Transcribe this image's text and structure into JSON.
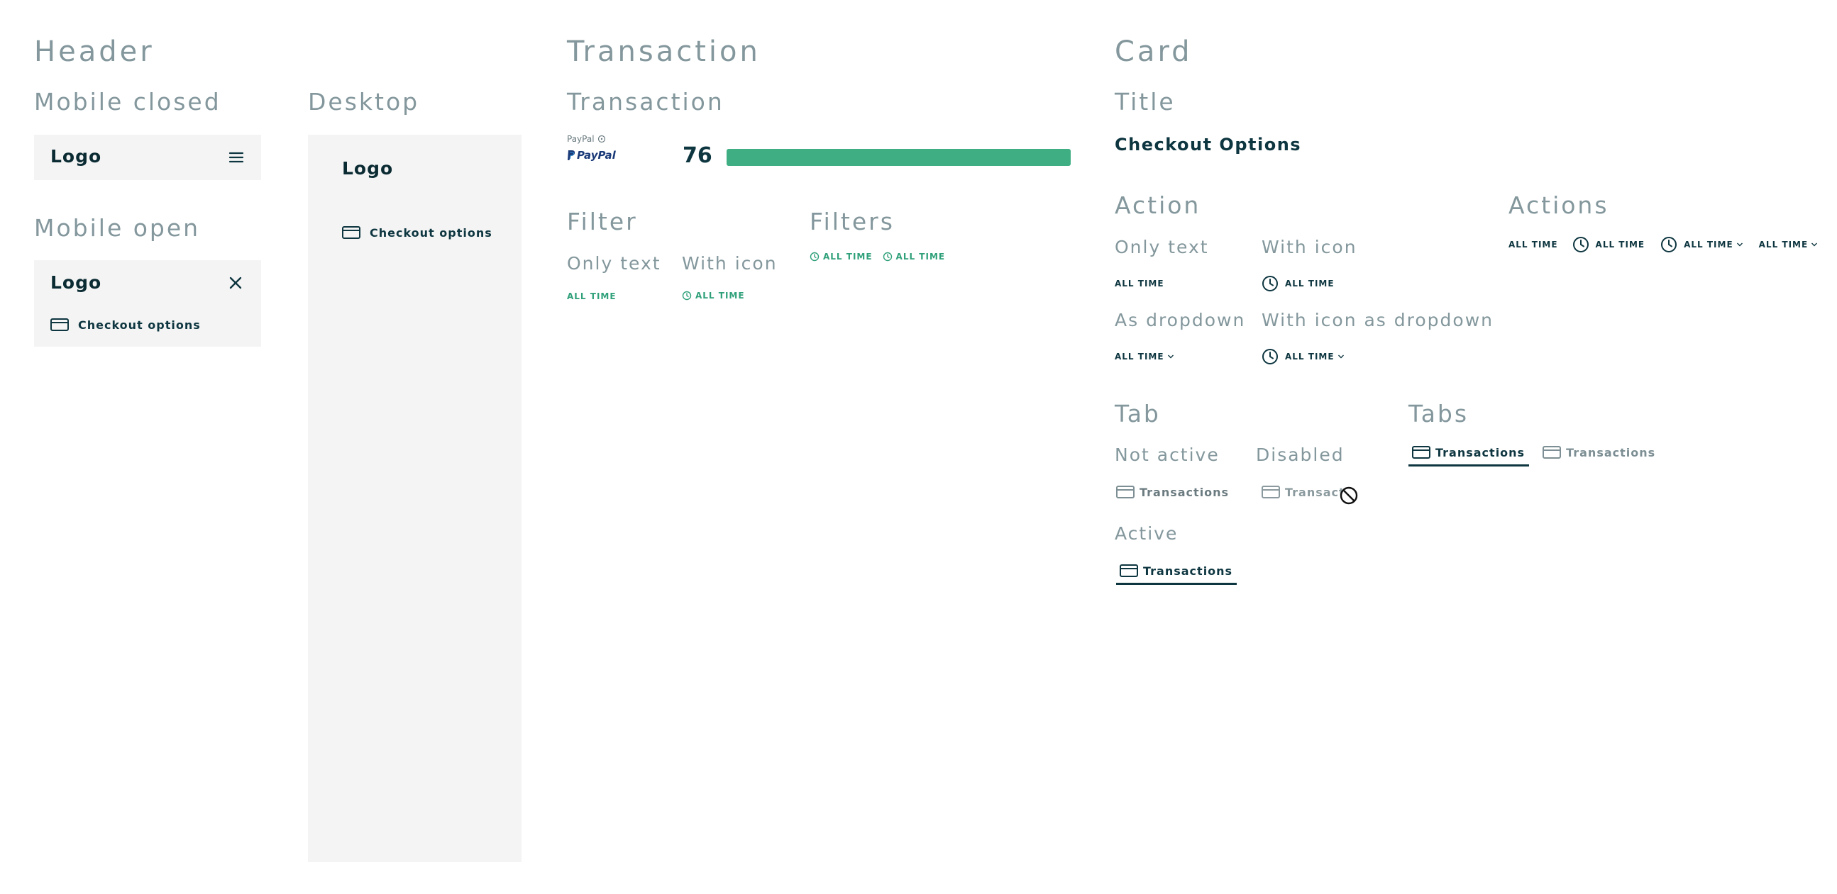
{
  "header": {
    "title": "Header",
    "mobile_closed": {
      "label": "Mobile closed",
      "logo": "Logo",
      "menu_icon": "hamburger-menu-icon"
    },
    "mobile_open": {
      "label": "Mobile open",
      "logo": "Logo",
      "close_icon": "close-icon",
      "nav_item": "Checkout options",
      "nav_icon": "credit-card-icon"
    },
    "desktop": {
      "label": "Desktop",
      "logo": "Logo",
      "nav_item": "Checkout options",
      "nav_icon": "credit-card-icon"
    }
  },
  "transaction": {
    "title": "Transaction",
    "sub_title": "Transaction",
    "provider_label": "PayPal",
    "provider_logo": "PayPal",
    "score": "76",
    "progress_fraction": 1.0,
    "filter": {
      "title": "Filter",
      "only_text_label": "Only text",
      "only_text_value": "ALL TIME",
      "with_icon_label": "With icon",
      "with_icon_value": "ALL TIME"
    },
    "filters": {
      "title": "Filters",
      "items": [
        "ALL TIME",
        "ALL TIME"
      ]
    }
  },
  "card": {
    "title": "Card",
    "title_section": {
      "label": "Title",
      "value": "Checkout Options"
    },
    "action": {
      "title": "Action",
      "only_text_label": "Only text",
      "only_text_value": "ALL TIME",
      "with_icon_label": "With icon",
      "with_icon_value": "ALL TIME",
      "dropdown_label": "As dropdown",
      "dropdown_value": "ALL TIME",
      "icon_dropdown_label": "With icon as dropdown",
      "icon_dropdown_value": "ALL TIME"
    },
    "actions": {
      "title": "Actions",
      "items": [
        "ALL TIME",
        "ALL TIME",
        "ALL TIME",
        "ALL TIME"
      ]
    },
    "tab": {
      "title": "Tab",
      "not_active_label": "Not active",
      "not_active_value": "Transactions",
      "disabled_label": "Disabled",
      "disabled_value": "Transactions",
      "active_label": "Active",
      "active_value": "Transactions"
    },
    "tabs": {
      "title": "Tabs",
      "items": [
        "Transactions",
        "Transactions"
      ]
    }
  },
  "colors": {
    "heading": "#83979c",
    "dark": "#0e3640",
    "green": "#2fa07a",
    "bar": "#3fae82",
    "panel": "#f4f4f4"
  }
}
